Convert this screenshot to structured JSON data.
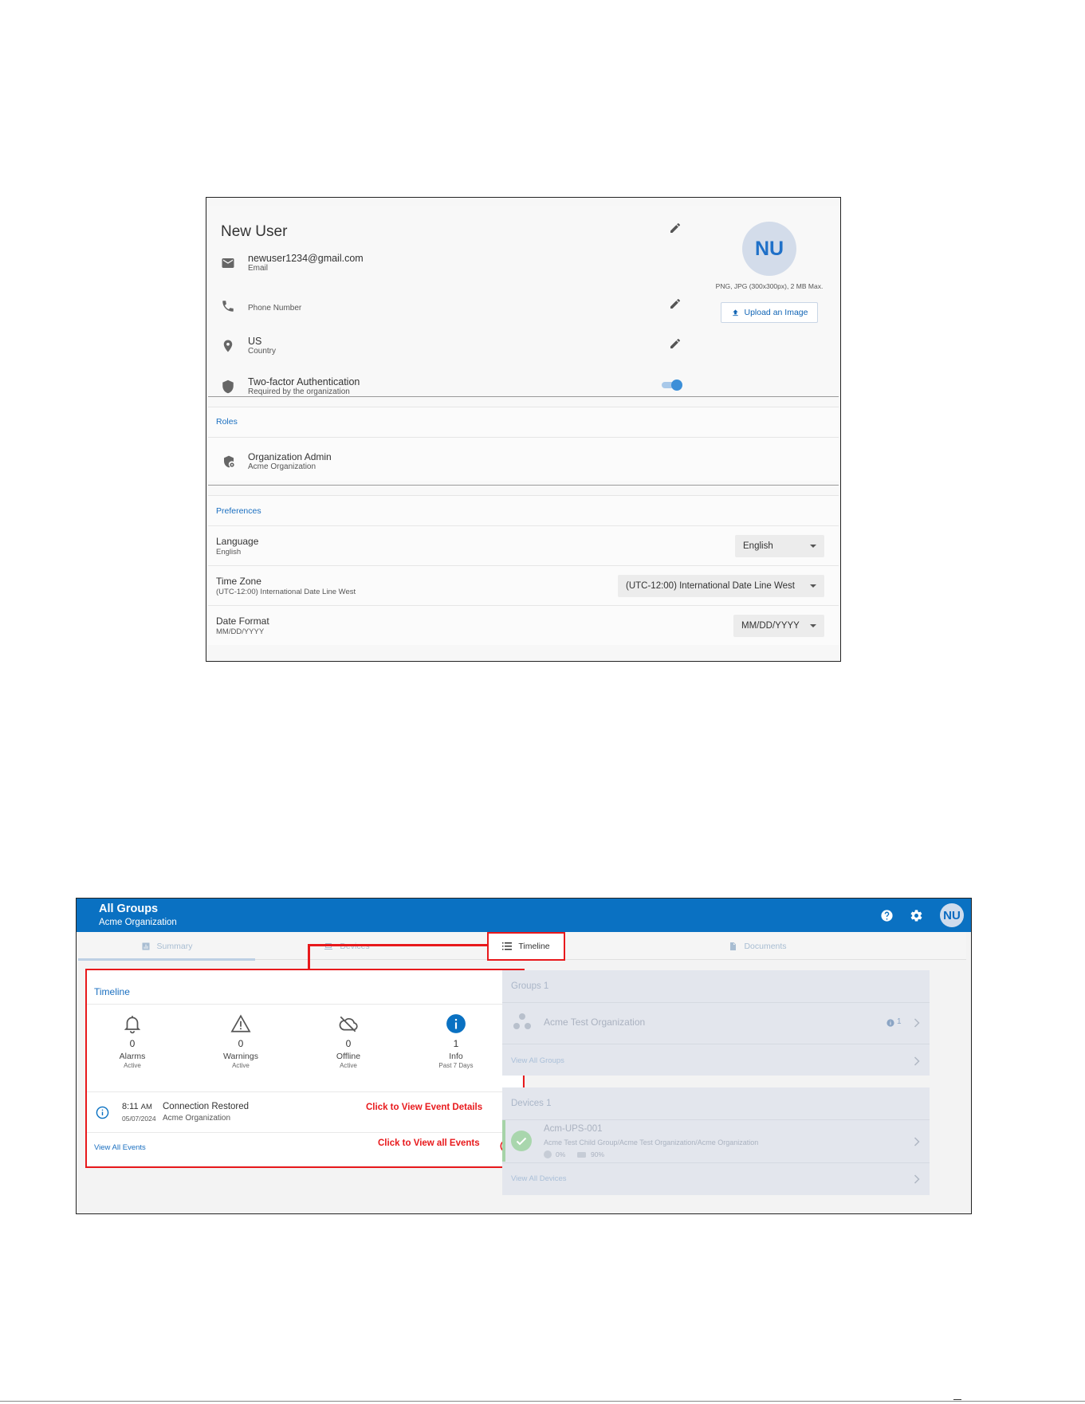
{
  "profile": {
    "user_name": "New User",
    "email": "newuser1234@gmail.com",
    "email_label": "Email",
    "phone_label": "Phone Number",
    "country": "US",
    "country_label": "Country",
    "twofa_title": "Two-factor Authentication",
    "twofa_sub": "Required by the organization",
    "twofa_enabled": true,
    "avatar_initials": "NU",
    "image_hint": "PNG, JPG (300x300px), 2 MB Max.",
    "upload_label": "Upload an Image",
    "roles_heading": "Roles",
    "role_title": "Organization Admin",
    "role_org": "Acme Organization",
    "preferences_heading": "Preferences",
    "preferences": [
      {
        "label": "Language",
        "value": "English",
        "selected": "English"
      },
      {
        "label": "Time Zone",
        "value": "(UTC-12:00) International Date Line West",
        "selected": "(UTC-12:00) International Date Line West"
      },
      {
        "label": "Date Format",
        "value": "MM/DD/YYYY",
        "selected": "MM/DD/YYYY"
      }
    ]
  },
  "dashboard": {
    "title": "All Groups",
    "subtitle": "Acme Organization",
    "avatar_initials": "NU",
    "tabs": [
      {
        "label": "Summary"
      },
      {
        "label": "Devices"
      },
      {
        "label": "Timeline"
      },
      {
        "label": "Documents"
      }
    ],
    "timeline": {
      "heading": "Timeline",
      "stats": [
        {
          "icon": "bell-icon",
          "count": "0",
          "label": "Alarms",
          "sub": "Active"
        },
        {
          "icon": "warning-icon",
          "count": "0",
          "label": "Warnings",
          "sub": "Active"
        },
        {
          "icon": "cloud-off-icon",
          "count": "0",
          "label": "Offline",
          "sub": "Active"
        },
        {
          "icon": "info-filled-icon",
          "count": "1",
          "label": "Info",
          "sub": "Past 7 Days"
        }
      ],
      "event": {
        "time": "8:11",
        "ampm": "AM",
        "date": "05/07/2024",
        "title": "Connection Restored",
        "org": "Acme Organization"
      },
      "view_all": "View All Events",
      "callout_event": "Click to View Event Details",
      "callout_all": "Click to View all Events"
    },
    "groups_card": {
      "heading": "Groups 1",
      "group_name": "Acme Test Organization",
      "badge_count": "1",
      "view_all": "View All Groups"
    },
    "devices_card": {
      "heading": "Devices 1",
      "device_name": "Acm-UPS-001",
      "device_path": "Acme Test Child Group/Acme Test Organization/Acme Organization",
      "load": "0%",
      "battery": "90%",
      "view_all": "View All Devices"
    },
    "colors": {
      "brand": "#0a71c2",
      "callout": "#e8191c",
      "link": "#1a6fc0"
    }
  }
}
